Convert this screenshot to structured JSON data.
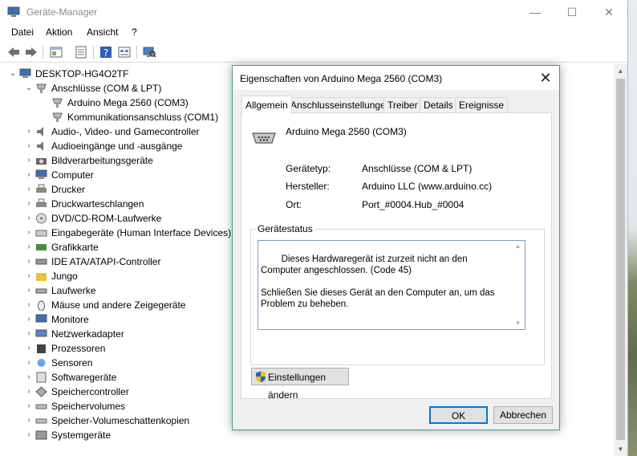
{
  "window": {
    "title": "Geräte-Manager",
    "minimize": "—",
    "maximize": "☐",
    "close": "✕"
  },
  "menu": [
    "Datei",
    "Aktion",
    "Ansicht",
    "?"
  ],
  "tree": {
    "root": "DESKTOP-HG4O2TF",
    "ports_category": "Anschlüsse (COM & LPT)",
    "ports_children": [
      "Arduino Mega 2560 (COM3)",
      "Kommunikationsanschluss (COM1)"
    ],
    "categories": [
      "Audio-, Video- und Gamecontroller",
      "Audioeingänge und -ausgänge",
      "Bildverarbeitungsgeräte",
      "Computer",
      "Drucker",
      "Druckwarteschlangen",
      "DVD/CD-ROM-Laufwerke",
      "Eingabegeräte (Human Interface Devices)",
      "Grafikkarte",
      "IDE ATA/ATAPI-Controller",
      "Jungo",
      "Laufwerke",
      "Mäuse und andere Zeigegeräte",
      "Monitore",
      "Netzwerkadapter",
      "Prozessoren",
      "Sensoren",
      "Softwaregeräte",
      "Speichercontroller",
      "Speichervolumes",
      "Speicher-Volumeschattenkopien",
      "Systemgeräte"
    ],
    "category_icons": [
      "speaker-icon",
      "speaker-icon",
      "camera-icon",
      "computer-icon",
      "printer-icon",
      "printer-icon",
      "dvd-icon",
      "keyboard-icon",
      "display-adapter-icon",
      "ide-controller-icon",
      "folder-icon",
      "drive-icon",
      "mouse-icon",
      "monitor-icon",
      "network-icon",
      "processor-icon",
      "sensor-icon",
      "software-icon",
      "storage-controller-icon",
      "storage-icon",
      "storage-icon",
      "system-icon"
    ]
  },
  "dialog": {
    "title": "Eigenschaften von Arduino Mega 2560 (COM3)",
    "close": "✕",
    "tabs": [
      "Allgemein",
      "Anschlusseinstellungen",
      "Treiber",
      "Details",
      "Ereignisse"
    ],
    "device_name": "Arduino Mega 2560 (COM3)",
    "fields": [
      {
        "label": "Gerätetyp:",
        "value": "Anschlüsse (COM & LPT)"
      },
      {
        "label": "Hersteller:",
        "value": "Arduino LLC (www.arduino.cc)"
      },
      {
        "label": "Ort:",
        "value": "Port_#0004.Hub_#0004"
      }
    ],
    "status_legend": "Gerätestatus",
    "status_text": "Dieses Hardwaregerät ist zurzeit nicht an den Computer angeschlossen. (Code 45)\n\nSchließen Sie dieses Gerät an den Computer an, um das Problem zu beheben.",
    "change_settings": "Einstellungen ändern",
    "ok": "OK",
    "cancel": "Abbrechen"
  },
  "colors": {
    "accent": "#0078d7",
    "dialog_border": "#3a9e8e",
    "shield_blue": "#1e64c8",
    "shield_yellow": "#f2c200"
  }
}
